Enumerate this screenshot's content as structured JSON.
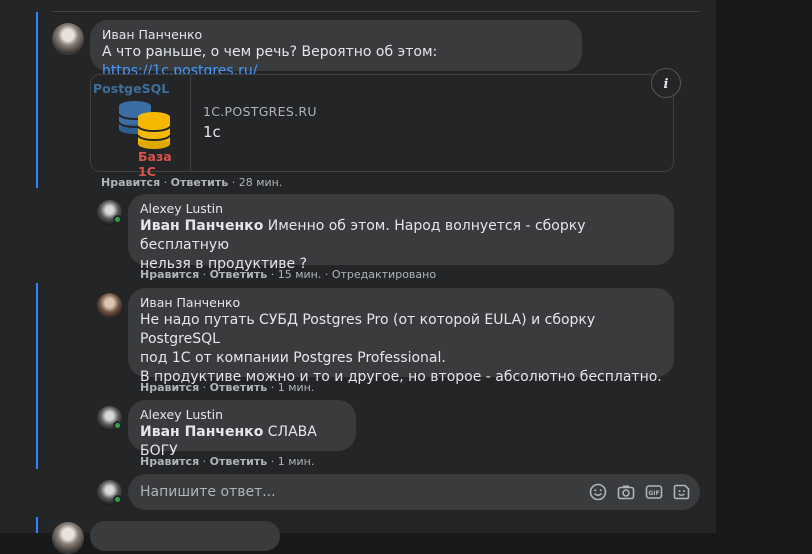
{
  "comments": [
    {
      "author": "Иван Панченко",
      "text": "А что раньше, о чем речь? Вероятно об этом: ",
      "link": "https://1c.postgres.ru/",
      "like": "Нравится",
      "reply": "Ответить",
      "time": "28 мин.",
      "preview": {
        "image_top_label": "PostgeSQL",
        "image_bottom_label": "База 1С",
        "domain": "1C.POSTGRES.RU",
        "title": "1с",
        "info_icon": "info-icon"
      }
    },
    {
      "author": "Alexey Lustin",
      "mention": "Иван Панченко",
      "line1": " Именно об этом. Народ волнуется - сборку бесплатную",
      "line2": "нельзя в продуктиве ?",
      "like": "Нравится",
      "reply": "Ответить",
      "time": "15 мин.",
      "edited": "Отредактировано"
    },
    {
      "author": "Иван Панченко",
      "line1": "Не надо путать СУБД Postgres Pro (от которой EULA) и сборку PostgreSQL",
      "line2": "под 1С от компании Postgres Professional.",
      "line3": "В продуктиве можно и то и другое, но второе - абсолютно бесплатно.",
      "like": "Нравится",
      "reply": "Ответить",
      "time": "1 мин."
    },
    {
      "author": "Alexey Lustin",
      "mention": "Иван Панченко",
      "text": " СЛАВА БОГУ",
      "like": "Нравится",
      "reply": "Ответить",
      "time": "1 мин."
    }
  ],
  "reply_box": {
    "placeholder": "Напишите ответ...",
    "icons": [
      "emoji-icon",
      "camera-icon",
      "gif-icon",
      "sticker-icon"
    ]
  },
  "colors": {
    "background": "#242526",
    "bubble": "#3a3b3c",
    "link": "#4599ff",
    "thread_line": "#2d88ff",
    "online": "#31a24c"
  }
}
